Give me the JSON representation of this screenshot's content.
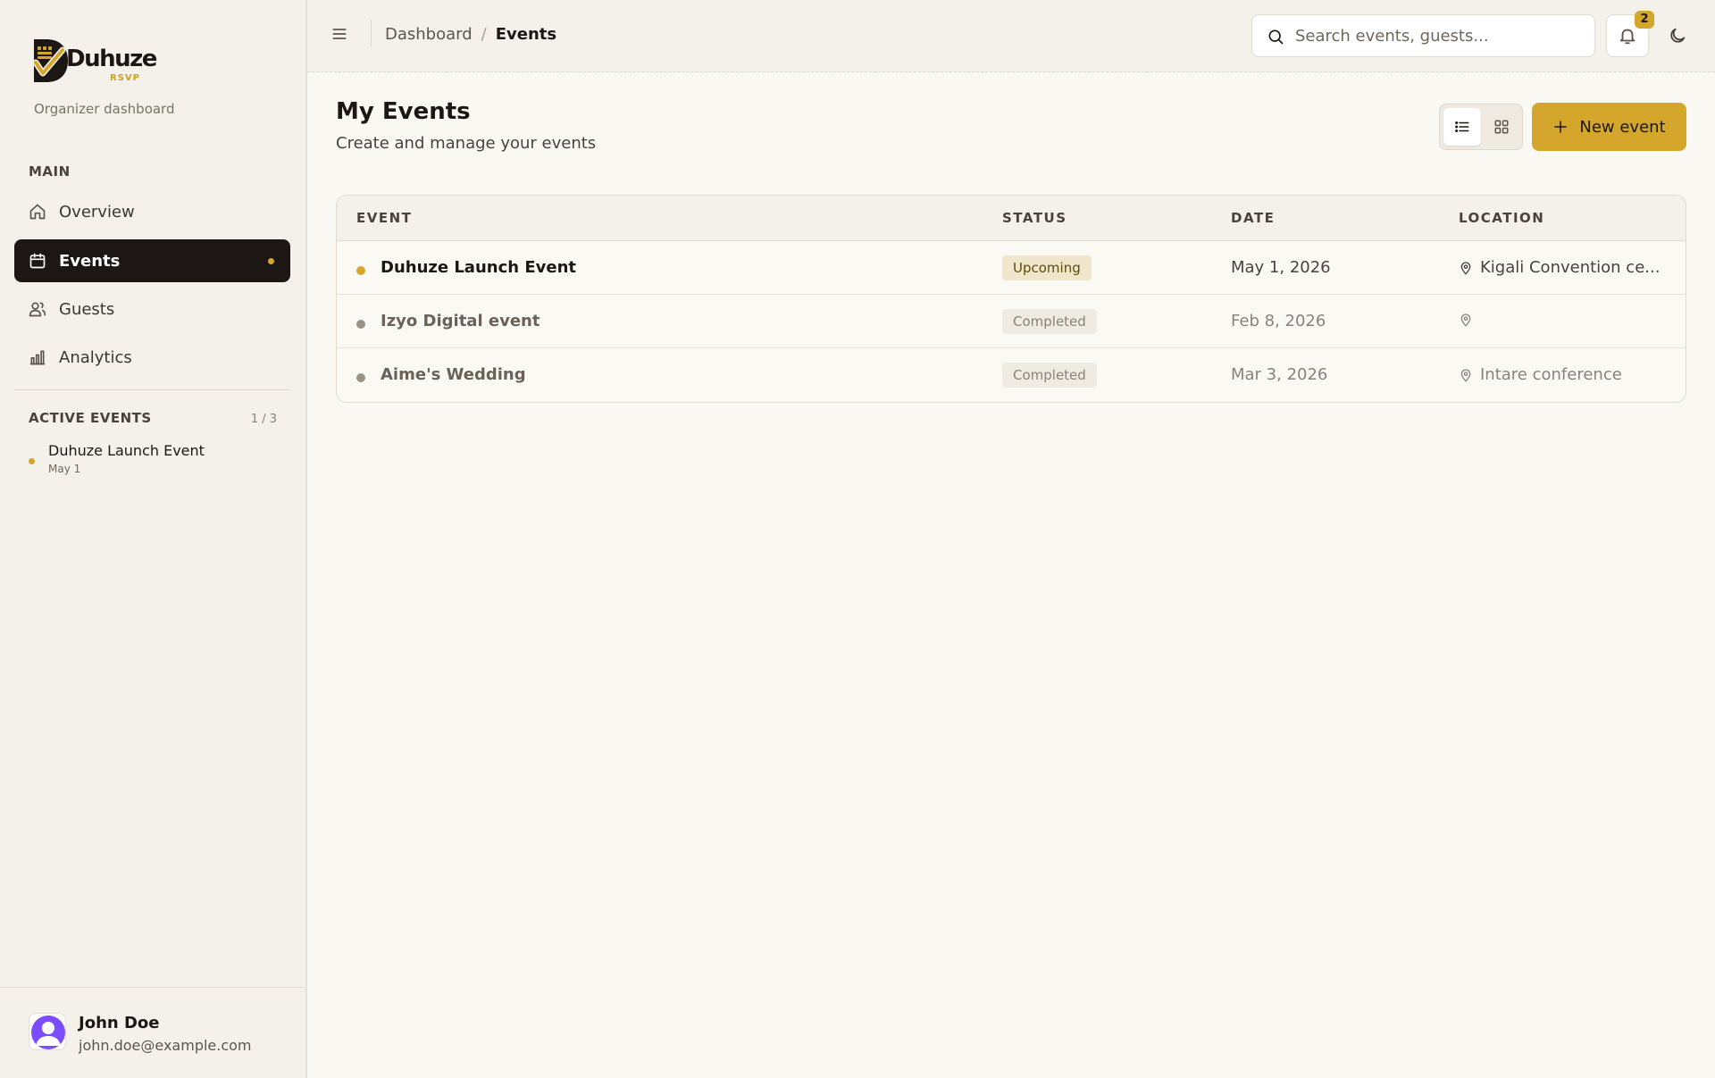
{
  "brand": {
    "wordmark": "Duhuze",
    "tag": "RSVP",
    "subtitle": "Organizer dashboard"
  },
  "sidebar": {
    "main_label": "MAIN",
    "items": [
      {
        "label": "Overview",
        "icon": "home-icon"
      },
      {
        "label": "Events",
        "icon": "calendar-icon",
        "active": true
      },
      {
        "label": "Guests",
        "icon": "users-icon"
      },
      {
        "label": "Analytics",
        "icon": "bar-chart-icon"
      }
    ],
    "active_events_label": "ACTIVE EVENTS",
    "active_events_count": "1 / 3",
    "active_events": [
      {
        "title": "Duhuze Launch Event",
        "date": "May 1"
      }
    ]
  },
  "user": {
    "name": "John Doe",
    "email": "john.doe@example.com"
  },
  "header": {
    "breadcrumb": [
      "Dashboard",
      "Events"
    ],
    "breadcrumb_sep": "/",
    "search_placeholder": "Search events, guests...",
    "notification_count": "2"
  },
  "page": {
    "title": "My Events",
    "subtitle": "Create and manage your events",
    "new_button": "New event",
    "view_mode": "list"
  },
  "table": {
    "columns": [
      "EVENT",
      "STATUS",
      "DATE",
      "LOCATION"
    ],
    "rows": [
      {
        "name": "Duhuze Launch Event",
        "status": "Upcoming",
        "date": "May 1, 2026",
        "location": "Kigali Convention ce..."
      },
      {
        "name": "Izyo Digital event",
        "status": "Completed",
        "date": "Feb 8, 2026",
        "location": ""
      },
      {
        "name": "Aime's Wedding",
        "status": "Completed",
        "date": "Mar 3, 2026",
        "location": "Intare conference"
      }
    ]
  },
  "colors": {
    "accent": "#d4a72c",
    "dark": "#1c1714",
    "background": "#faf8f3"
  }
}
